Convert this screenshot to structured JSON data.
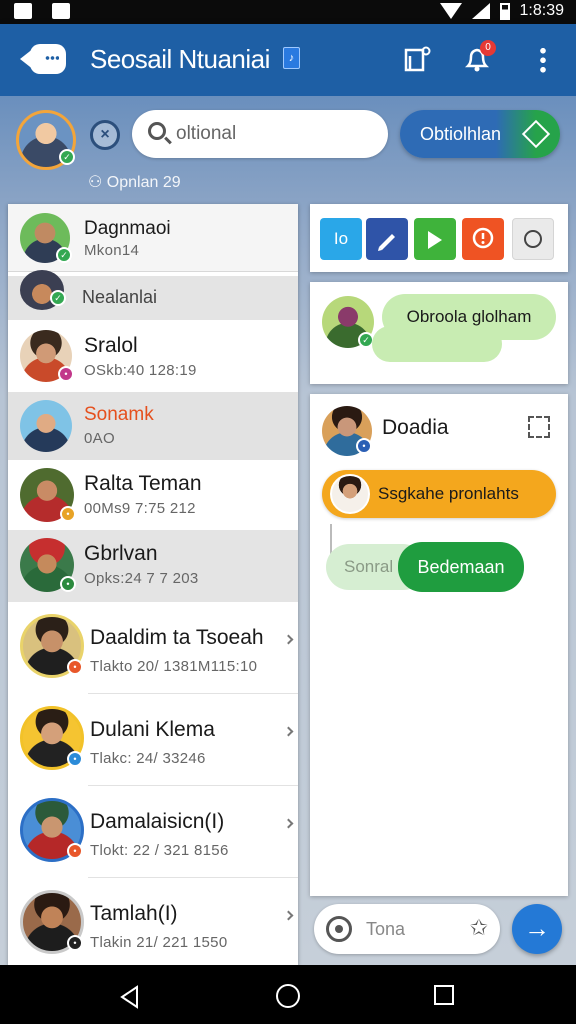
{
  "status_bar": {
    "time": "1:8:39",
    "icons": [
      "app-icon",
      "image-icon",
      "wifi-icon",
      "signal-icon",
      "battery-icon"
    ]
  },
  "app_bar": {
    "title": "Seosail Ntuaniai",
    "badge": "♪",
    "notification_count": "0",
    "icons": [
      "chat-back-icon",
      "contact-card-icon",
      "bell-icon",
      "more-vert-icon"
    ]
  },
  "header": {
    "search_placeholder": "oltional",
    "action_button_label": "Obtiolhlan",
    "sub_status": "Opnlan 29"
  },
  "contacts": [
    {
      "name": "Dagnmaoi",
      "sub": "Mkon14"
    },
    {
      "name": "Nealanlai",
      "sub": ""
    },
    {
      "name": "Sralol",
      "sub": "OSkb:40 128:19"
    },
    {
      "name": "Sonamk",
      "sub": "0AO"
    },
    {
      "name": "Ralta Teman",
      "sub": "00Ms9 7:75 212"
    },
    {
      "name": "Gbrlvan",
      "sub": "Opks:24 7 7 203"
    },
    {
      "name": "Daaldim ta Tsoeah",
      "sub": "Tlakto 20/ 1381M115:10"
    },
    {
      "name": "Dulani Klema",
      "sub": "Tlakc: 24/ 33246"
    },
    {
      "name": "Damalaisicn(I)",
      "sub": "Tlokt: 22 / 321 8156"
    },
    {
      "name": "Tamlah(I)",
      "sub": "Tlakin 21/ 221 1550"
    }
  ],
  "toolbar": {
    "buttons": [
      {
        "label": "Io",
        "color": "#2aa7e8"
      },
      {
        "label": "",
        "color": "#2f54a8",
        "icon": "pen-icon"
      },
      {
        "label": "",
        "color": "#3fb33b",
        "icon": "play-icon"
      },
      {
        "label": "",
        "color": "#ef5323",
        "icon": "alert-chat-icon"
      },
      {
        "label": "",
        "color": "#eaeaea",
        "icon": "circle-icon"
      }
    ]
  },
  "bubbles": {
    "green_bubble_text": "Obroola glolham",
    "chat_title": "Doadia",
    "orange_bubble_text": "Ssgkahe pronlahts",
    "faded_bubble_text": "Sonral",
    "dark_green_bubble_text": "Bedemaan"
  },
  "composer": {
    "placeholder": "Tona"
  },
  "colors": {
    "primary": "#1e5fa5",
    "accent_green": "#1f9d3f",
    "accent_orange": "#f4a71d",
    "highlight_name": "#e5501e"
  }
}
